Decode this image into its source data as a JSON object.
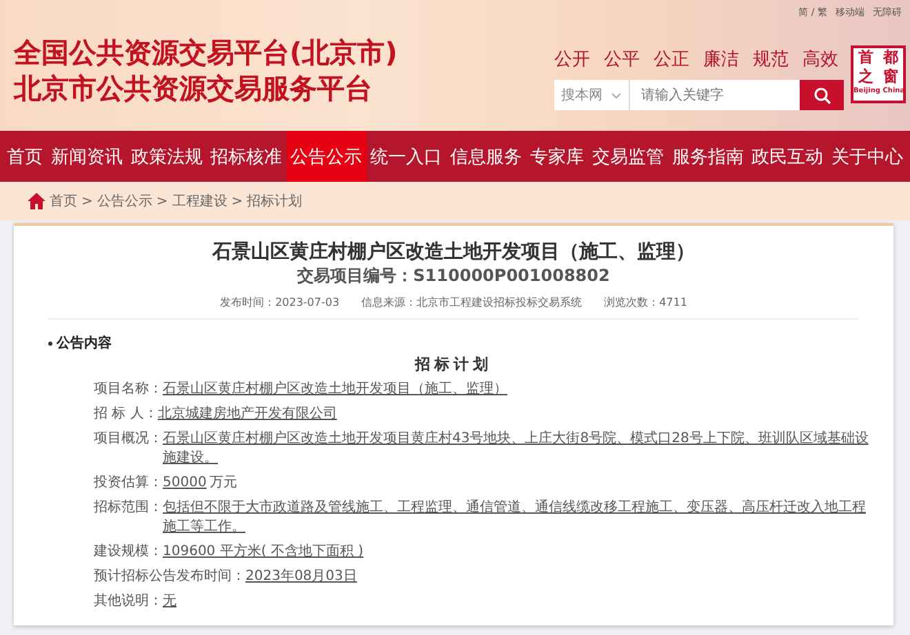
{
  "header": {
    "utility_links": [
      "简 / 繁",
      "移动端",
      "无障碍"
    ],
    "title_lines": [
      "全国公共资源交易平台(北京市)",
      "北京市公共资源交易服务平台"
    ],
    "slogans": [
      "公开",
      "公平",
      "公正",
      "廉洁",
      "规范",
      "高效"
    ],
    "search": {
      "scope": "搜本网",
      "placeholder": "请输入关键字"
    },
    "logo": {
      "characters": [
        "首",
        "都",
        "之",
        "窗"
      ],
      "caption": "Beijing China"
    }
  },
  "nav": [
    {
      "label": "首页",
      "selected": false
    },
    {
      "label": "新闻资讯",
      "selected": false
    },
    {
      "label": "政策法规",
      "selected": false
    },
    {
      "label": "招标核准",
      "selected": false
    },
    {
      "label": "公告公示",
      "selected": true
    },
    {
      "label": "统一入口",
      "selected": false
    },
    {
      "label": "信息服务",
      "selected": false
    },
    {
      "label": "专家库",
      "selected": false
    },
    {
      "label": "交易监管",
      "selected": false
    },
    {
      "label": "服务指南",
      "selected": false
    },
    {
      "label": "政民互动",
      "selected": false
    },
    {
      "label": "关于中心",
      "selected": false
    }
  ],
  "breadcrumb": {
    "separator": ">",
    "items": [
      "首页",
      "公告公示",
      "工程建设",
      "招标计划"
    ]
  },
  "notice": {
    "title": "石景山区黄庄村棚户区改造土地开发项目（施工、监理）",
    "project_number": "交易项目编号：S110000P001008802",
    "meta": [
      {
        "label": "发布时间：",
        "value": "2023-07-03"
      },
      {
        "label": "信息来源：",
        "value": "北京市工程建设招标投标交易系统"
      },
      {
        "label": "浏览次数：",
        "value": "4711"
      }
    ],
    "section_heading": "公告内容",
    "document_title": "招标计划",
    "fields": [
      {
        "label": "项目名称：",
        "value": "石景山区黄庄村棚户区改造土地开发项目（施工、监理）"
      },
      {
        "label": "招 标 人：",
        "value": "北京城建房地产开发有限公司"
      },
      {
        "label": "项目概况：",
        "value": "石景山区黄庄村棚户区改造土地开发项目黄庄村43号地块、上庄大街8号院、模式口28号上下院、班训队区域基础设施建设。"
      },
      {
        "label": "投资估算：",
        "value": "50000",
        "suffix": "万元"
      },
      {
        "label": "招标范围：",
        "value": "包括但不限于大市政道路及管线施工、工程监理、通信管道、通信线缆改移工程施工、变压器、高压杆迁改入地工程施工等工作。"
      },
      {
        "label": "建设规模：",
        "value": "109600 平方米( 不含地下面积 )"
      },
      {
        "label": "预计招标公告发布时间：",
        "value": "2023年08月03日"
      },
      {
        "label": "其他说明：",
        "value": "无"
      }
    ]
  }
}
